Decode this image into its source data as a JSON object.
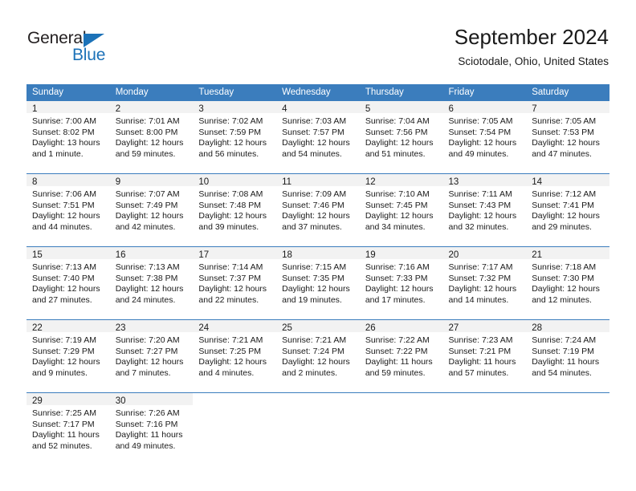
{
  "brand": {
    "name_part1": "General",
    "name_part2": "Blue",
    "accent_color": "#1c72b8"
  },
  "header": {
    "title": "September 2024",
    "location": "Sciotodale, Ohio, United States"
  },
  "theme": {
    "header_blue": "#3b7dbd",
    "daynum_bg": "#f2f2f2",
    "text": "#1a1a1a"
  },
  "weekdays": [
    "Sunday",
    "Monday",
    "Tuesday",
    "Wednesday",
    "Thursday",
    "Friday",
    "Saturday"
  ],
  "weeks": [
    [
      {
        "day": "1",
        "sunrise": "Sunrise: 7:00 AM",
        "sunset": "Sunset: 8:02 PM",
        "daylight1": "Daylight: 13 hours",
        "daylight2": "and 1 minute."
      },
      {
        "day": "2",
        "sunrise": "Sunrise: 7:01 AM",
        "sunset": "Sunset: 8:00 PM",
        "daylight1": "Daylight: 12 hours",
        "daylight2": "and 59 minutes."
      },
      {
        "day": "3",
        "sunrise": "Sunrise: 7:02 AM",
        "sunset": "Sunset: 7:59 PM",
        "daylight1": "Daylight: 12 hours",
        "daylight2": "and 56 minutes."
      },
      {
        "day": "4",
        "sunrise": "Sunrise: 7:03 AM",
        "sunset": "Sunset: 7:57 PM",
        "daylight1": "Daylight: 12 hours",
        "daylight2": "and 54 minutes."
      },
      {
        "day": "5",
        "sunrise": "Sunrise: 7:04 AM",
        "sunset": "Sunset: 7:56 PM",
        "daylight1": "Daylight: 12 hours",
        "daylight2": "and 51 minutes."
      },
      {
        "day": "6",
        "sunrise": "Sunrise: 7:05 AM",
        "sunset": "Sunset: 7:54 PM",
        "daylight1": "Daylight: 12 hours",
        "daylight2": "and 49 minutes."
      },
      {
        "day": "7",
        "sunrise": "Sunrise: 7:05 AM",
        "sunset": "Sunset: 7:53 PM",
        "daylight1": "Daylight: 12 hours",
        "daylight2": "and 47 minutes."
      }
    ],
    [
      {
        "day": "8",
        "sunrise": "Sunrise: 7:06 AM",
        "sunset": "Sunset: 7:51 PM",
        "daylight1": "Daylight: 12 hours",
        "daylight2": "and 44 minutes."
      },
      {
        "day": "9",
        "sunrise": "Sunrise: 7:07 AM",
        "sunset": "Sunset: 7:49 PM",
        "daylight1": "Daylight: 12 hours",
        "daylight2": "and 42 minutes."
      },
      {
        "day": "10",
        "sunrise": "Sunrise: 7:08 AM",
        "sunset": "Sunset: 7:48 PM",
        "daylight1": "Daylight: 12 hours",
        "daylight2": "and 39 minutes."
      },
      {
        "day": "11",
        "sunrise": "Sunrise: 7:09 AM",
        "sunset": "Sunset: 7:46 PM",
        "daylight1": "Daylight: 12 hours",
        "daylight2": "and 37 minutes."
      },
      {
        "day": "12",
        "sunrise": "Sunrise: 7:10 AM",
        "sunset": "Sunset: 7:45 PM",
        "daylight1": "Daylight: 12 hours",
        "daylight2": "and 34 minutes."
      },
      {
        "day": "13",
        "sunrise": "Sunrise: 7:11 AM",
        "sunset": "Sunset: 7:43 PM",
        "daylight1": "Daylight: 12 hours",
        "daylight2": "and 32 minutes."
      },
      {
        "day": "14",
        "sunrise": "Sunrise: 7:12 AM",
        "sunset": "Sunset: 7:41 PM",
        "daylight1": "Daylight: 12 hours",
        "daylight2": "and 29 minutes."
      }
    ],
    [
      {
        "day": "15",
        "sunrise": "Sunrise: 7:13 AM",
        "sunset": "Sunset: 7:40 PM",
        "daylight1": "Daylight: 12 hours",
        "daylight2": "and 27 minutes."
      },
      {
        "day": "16",
        "sunrise": "Sunrise: 7:13 AM",
        "sunset": "Sunset: 7:38 PM",
        "daylight1": "Daylight: 12 hours",
        "daylight2": "and 24 minutes."
      },
      {
        "day": "17",
        "sunrise": "Sunrise: 7:14 AM",
        "sunset": "Sunset: 7:37 PM",
        "daylight1": "Daylight: 12 hours",
        "daylight2": "and 22 minutes."
      },
      {
        "day": "18",
        "sunrise": "Sunrise: 7:15 AM",
        "sunset": "Sunset: 7:35 PM",
        "daylight1": "Daylight: 12 hours",
        "daylight2": "and 19 minutes."
      },
      {
        "day": "19",
        "sunrise": "Sunrise: 7:16 AM",
        "sunset": "Sunset: 7:33 PM",
        "daylight1": "Daylight: 12 hours",
        "daylight2": "and 17 minutes."
      },
      {
        "day": "20",
        "sunrise": "Sunrise: 7:17 AM",
        "sunset": "Sunset: 7:32 PM",
        "daylight1": "Daylight: 12 hours",
        "daylight2": "and 14 minutes."
      },
      {
        "day": "21",
        "sunrise": "Sunrise: 7:18 AM",
        "sunset": "Sunset: 7:30 PM",
        "daylight1": "Daylight: 12 hours",
        "daylight2": "and 12 minutes."
      }
    ],
    [
      {
        "day": "22",
        "sunrise": "Sunrise: 7:19 AM",
        "sunset": "Sunset: 7:29 PM",
        "daylight1": "Daylight: 12 hours",
        "daylight2": "and 9 minutes."
      },
      {
        "day": "23",
        "sunrise": "Sunrise: 7:20 AM",
        "sunset": "Sunset: 7:27 PM",
        "daylight1": "Daylight: 12 hours",
        "daylight2": "and 7 minutes."
      },
      {
        "day": "24",
        "sunrise": "Sunrise: 7:21 AM",
        "sunset": "Sunset: 7:25 PM",
        "daylight1": "Daylight: 12 hours",
        "daylight2": "and 4 minutes."
      },
      {
        "day": "25",
        "sunrise": "Sunrise: 7:21 AM",
        "sunset": "Sunset: 7:24 PM",
        "daylight1": "Daylight: 12 hours",
        "daylight2": "and 2 minutes."
      },
      {
        "day": "26",
        "sunrise": "Sunrise: 7:22 AM",
        "sunset": "Sunset: 7:22 PM",
        "daylight1": "Daylight: 11 hours",
        "daylight2": "and 59 minutes."
      },
      {
        "day": "27",
        "sunrise": "Sunrise: 7:23 AM",
        "sunset": "Sunset: 7:21 PM",
        "daylight1": "Daylight: 11 hours",
        "daylight2": "and 57 minutes."
      },
      {
        "day": "28",
        "sunrise": "Sunrise: 7:24 AM",
        "sunset": "Sunset: 7:19 PM",
        "daylight1": "Daylight: 11 hours",
        "daylight2": "and 54 minutes."
      }
    ],
    [
      {
        "day": "29",
        "sunrise": "Sunrise: 7:25 AM",
        "sunset": "Sunset: 7:17 PM",
        "daylight1": "Daylight: 11 hours",
        "daylight2": "and 52 minutes."
      },
      {
        "day": "30",
        "sunrise": "Sunrise: 7:26 AM",
        "sunset": "Sunset: 7:16 PM",
        "daylight1": "Daylight: 11 hours",
        "daylight2": "and 49 minutes."
      },
      {
        "day": "",
        "sunrise": "",
        "sunset": "",
        "daylight1": "",
        "daylight2": ""
      },
      {
        "day": "",
        "sunrise": "",
        "sunset": "",
        "daylight1": "",
        "daylight2": ""
      },
      {
        "day": "",
        "sunrise": "",
        "sunset": "",
        "daylight1": "",
        "daylight2": ""
      },
      {
        "day": "",
        "sunrise": "",
        "sunset": "",
        "daylight1": "",
        "daylight2": ""
      },
      {
        "day": "",
        "sunrise": "",
        "sunset": "",
        "daylight1": "",
        "daylight2": ""
      }
    ]
  ]
}
